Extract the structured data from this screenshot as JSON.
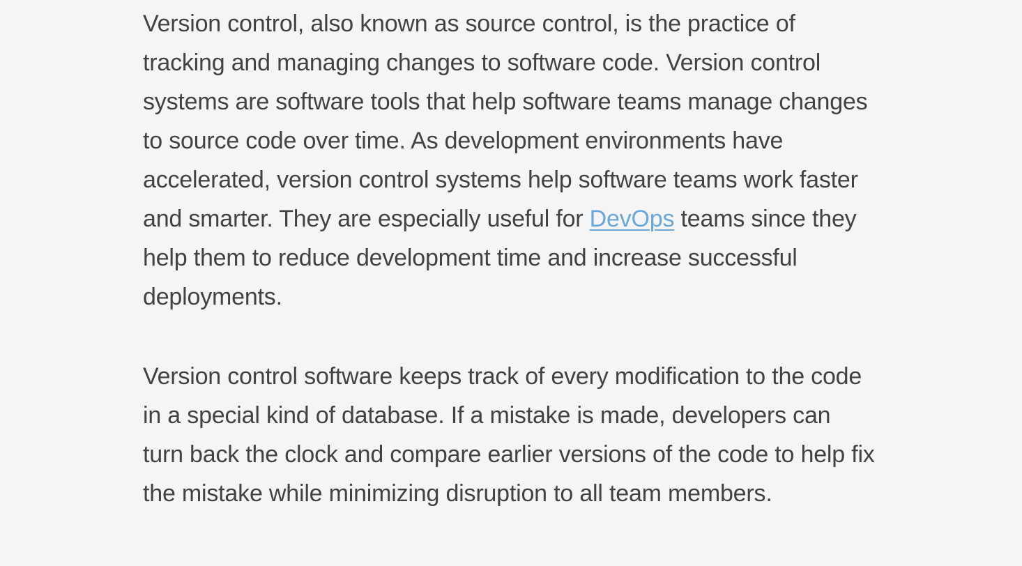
{
  "article": {
    "paragraph_1": {
      "before_link": "Version control, also known as source control, is the practice of tracking and managing changes to software code. Version control systems are software tools that help software teams manage changes to source code over time. As development environments have accelerated, version control systems help software teams work faster and smarter. They are especially useful for ",
      "link_text": "DevOps",
      "after_link": " teams since they help them to reduce development time and increase successful deployments."
    },
    "paragraph_2": "Version control software keeps track of every modification to the code in a special kind of database. If a mistake is made, developers can turn back the clock and compare earlier versions of the code to help fix the mistake while minimizing disruption to all team members."
  },
  "colors": {
    "background": "#f5f5f5",
    "text": "#424242",
    "link": "#6aa8dc"
  }
}
